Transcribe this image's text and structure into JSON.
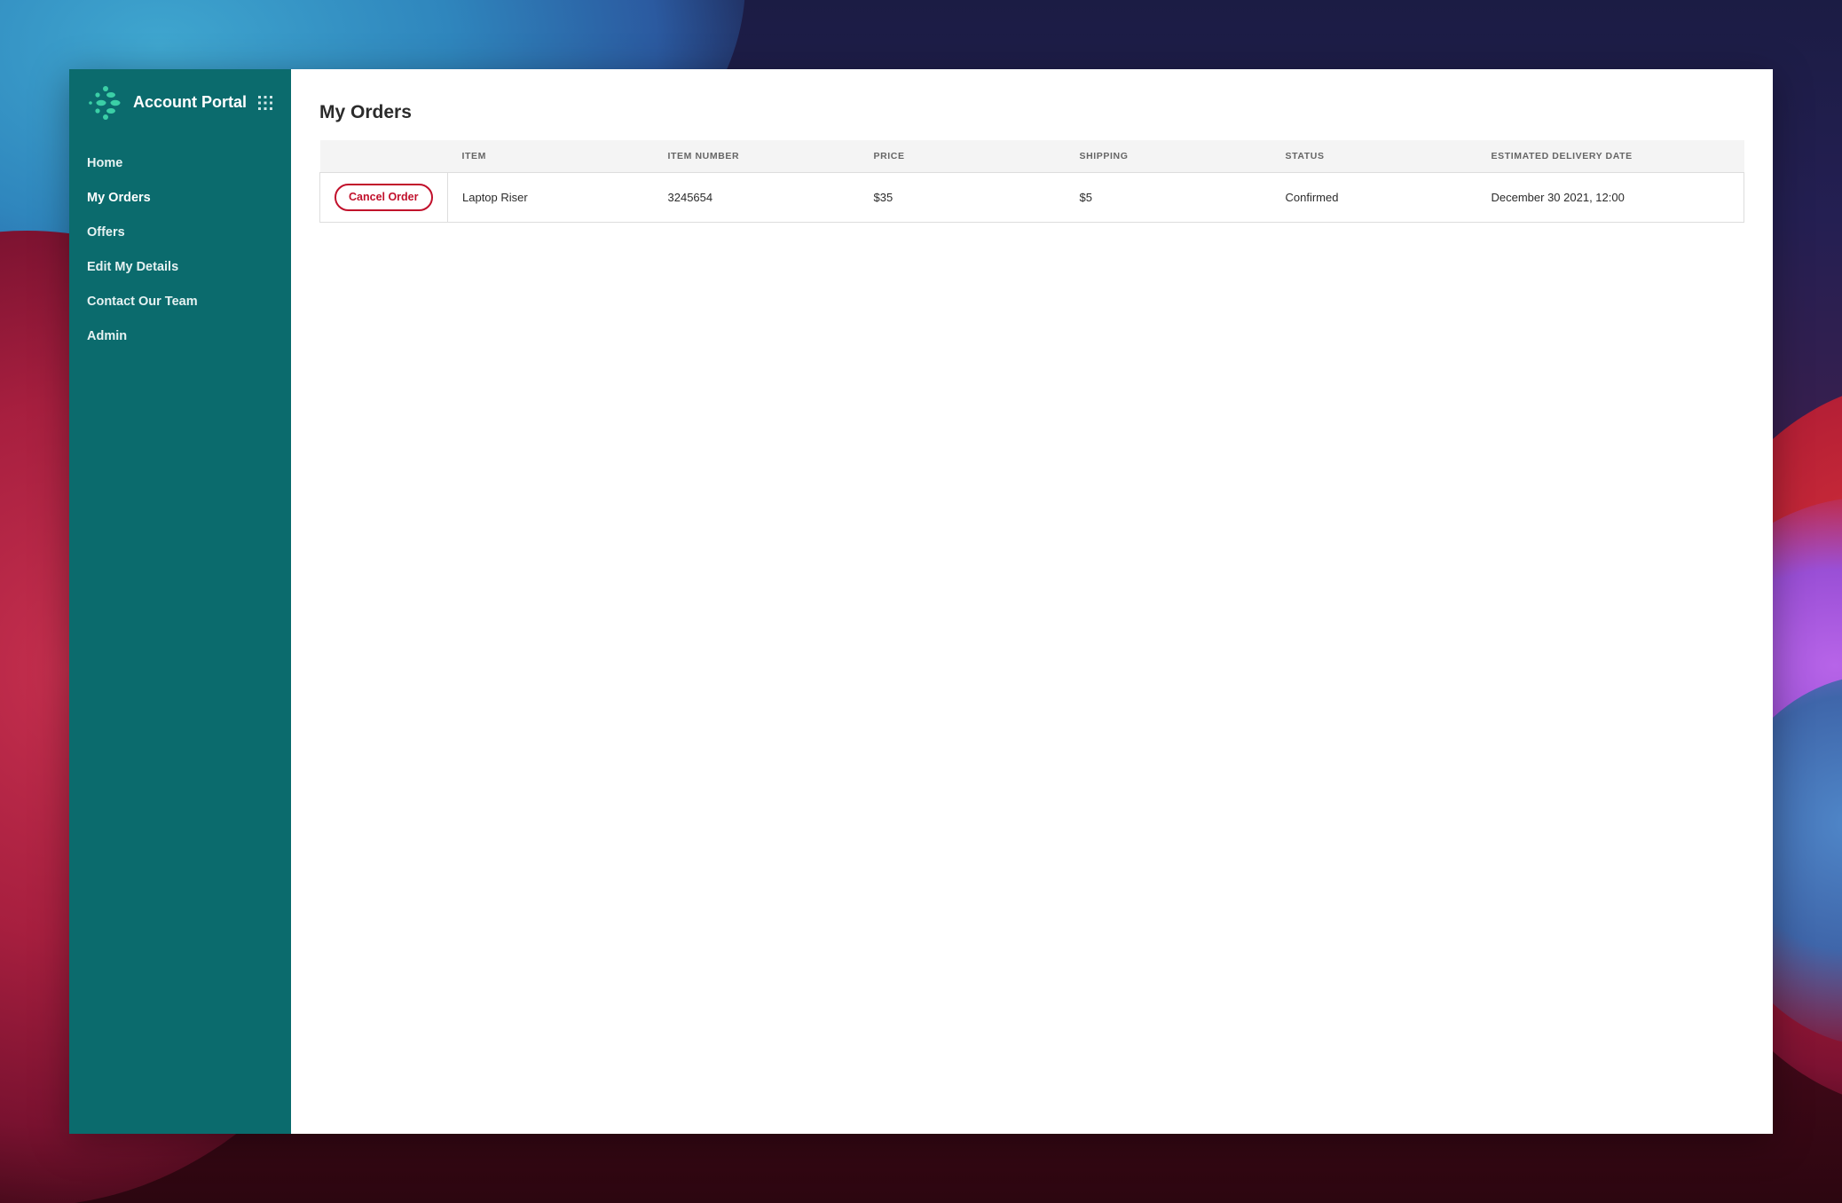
{
  "app": {
    "title": "Account Portal",
    "logo_icon": "dots-logo-icon",
    "apps_icon": "grid-icon",
    "accent_color": "#0b6b6d",
    "logo_color": "#3bcfa6"
  },
  "sidebar": {
    "items": [
      {
        "label": "Home"
      },
      {
        "label": "My Orders",
        "active": true
      },
      {
        "label": "Offers"
      },
      {
        "label": "Edit My Details"
      },
      {
        "label": "Contact Our Team"
      },
      {
        "label": "Admin"
      }
    ]
  },
  "main": {
    "title": "My Orders",
    "table": {
      "columns": [
        "",
        "ITEM",
        "ITEM NUMBER",
        "PRICE",
        "SHIPPING",
        "STATUS",
        "ESTIMATED DELIVERY DATE"
      ],
      "rows": [
        {
          "action_label": "Cancel Order",
          "item": "Laptop Riser",
          "item_number": "3245654",
          "price": "$35",
          "shipping": "$5",
          "status": "Confirmed",
          "delivery_date": "December 30 2021, 12:00"
        }
      ]
    },
    "cancel_color": "#c1102b"
  }
}
